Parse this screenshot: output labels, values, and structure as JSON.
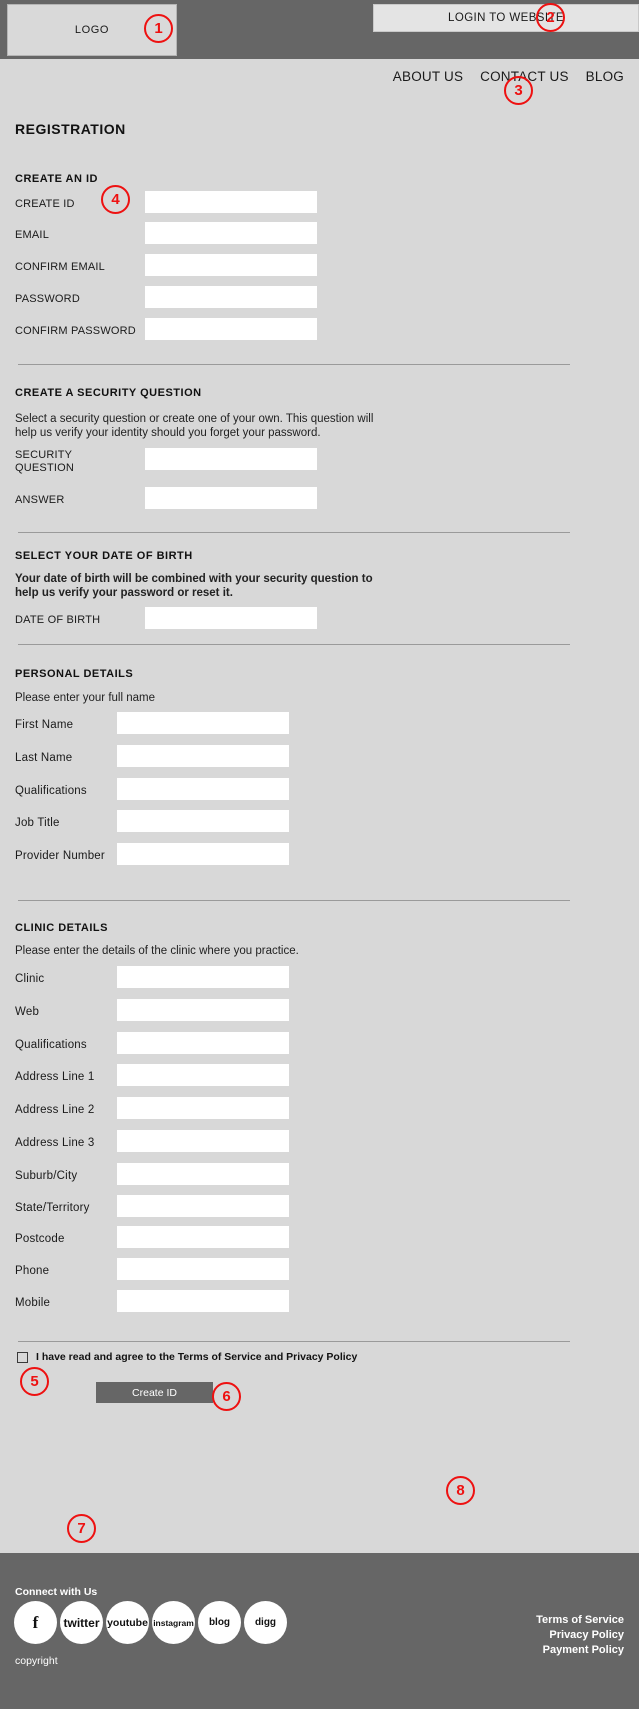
{
  "header": {
    "logo_label": "LOGO",
    "login_label": "LOGIN TO WEBSITE"
  },
  "nav": {
    "items": [
      {
        "label": "ABOUT US"
      },
      {
        "label": "CONTACT US"
      },
      {
        "label": "BLOG"
      }
    ]
  },
  "page": {
    "title": "REGISTRATION"
  },
  "sections": {
    "create_id": {
      "heading": "CREATE AN ID",
      "fields": [
        {
          "label": "CREATE ID",
          "value": "",
          "placeholder": ""
        },
        {
          "label": "EMAIL",
          "value": "",
          "placeholder": ""
        },
        {
          "label": "CONFIRM EMAIL",
          "value": "",
          "placeholder": ""
        },
        {
          "label": "PASSWORD",
          "value": "",
          "placeholder": ""
        },
        {
          "label": "CONFIRM PASSWORD",
          "value": "",
          "placeholder": ""
        }
      ]
    },
    "security_question": {
      "heading": "CREATE A SECURITY QUESTION",
      "note_line1": "Select a security question or create one of your own. This question will",
      "note_line2": "help us verify your identity should you forget your password.",
      "fields": [
        {
          "label_line1": "SECURITY",
          "label_line2": "QUESTION",
          "value": "",
          "placeholder": ""
        },
        {
          "label_line1": "ANSWER",
          "label_line2": "",
          "value": "",
          "placeholder": ""
        }
      ]
    },
    "date_of_birth": {
      "heading": "SELECT YOUR DATE OF BIRTH",
      "note_line1": "Your date of birth will be combined with your security question to",
      "note_line2": "help us verify your password or reset it.",
      "fields": [
        {
          "label": "DATE OF BIRTH",
          "value": "",
          "placeholder": ""
        }
      ]
    },
    "personal_details": {
      "heading": "PERSONAL DETAILS",
      "note": "Please enter your full name",
      "fields": [
        {
          "label": "First Name",
          "value": "",
          "placeholder": ""
        },
        {
          "label": "Last Name",
          "value": "",
          "placeholder": ""
        },
        {
          "label": "Qualifications",
          "value": "",
          "placeholder": ""
        },
        {
          "label": "Job Title",
          "value": "",
          "placeholder": ""
        },
        {
          "label": "Provider Number",
          "value": "",
          "placeholder": ""
        }
      ]
    },
    "clinic_details": {
      "heading": "CLINIC DETAILS",
      "note": "Please enter the details of the clinic where you practice.",
      "fields": [
        {
          "label": "Clinic",
          "value": "",
          "placeholder": ""
        },
        {
          "label": "Web",
          "value": "",
          "placeholder": ""
        },
        {
          "label": "Qualifications",
          "value": "",
          "placeholder": ""
        },
        {
          "label": "Address Line 1",
          "value": "",
          "placeholder": ""
        },
        {
          "label": "Address Line 2",
          "value": "",
          "placeholder": ""
        },
        {
          "label": "Address Line 3",
          "value": "",
          "placeholder": ""
        },
        {
          "label": "Suburb/City",
          "value": "",
          "placeholder": ""
        },
        {
          "label": "State/Territory",
          "value": "",
          "placeholder": ""
        },
        {
          "label": "Postcode",
          "value": "",
          "placeholder": ""
        },
        {
          "label": "Phone",
          "value": "",
          "placeholder": ""
        },
        {
          "label": "Mobile",
          "value": "",
          "placeholder": ""
        }
      ]
    }
  },
  "agreement": {
    "checkbox_checked": false,
    "text": "I have read and agree to the Terms of Service and Privacy Policy",
    "submit_label": "Create ID"
  },
  "footer": {
    "connect_label": "Connect with Us",
    "social": [
      {
        "name": "facebook",
        "label": "f"
      },
      {
        "name": "twitter",
        "label": "twitter"
      },
      {
        "name": "youtube",
        "label": "youtube"
      },
      {
        "name": "instagram",
        "label": "instagram"
      },
      {
        "name": "blog",
        "label": "blog"
      },
      {
        "name": "digg",
        "label": "digg"
      }
    ],
    "copyright": "copyright",
    "policy_links": [
      {
        "label": "Terms of Service"
      },
      {
        "label": "Privacy Policy"
      },
      {
        "label": "Payment Policy"
      }
    ]
  },
  "annotations": [
    {
      "number": "1"
    },
    {
      "number": "2"
    },
    {
      "number": "3"
    },
    {
      "number": "4"
    },
    {
      "number": "5"
    },
    {
      "number": "6"
    },
    {
      "number": "7"
    },
    {
      "number": "8"
    }
  ],
  "colors": {
    "header_bg": "#666666",
    "page_bg": "#d8d8d8",
    "accent_annotation": "#ee1111",
    "button_bg": "#666666"
  }
}
